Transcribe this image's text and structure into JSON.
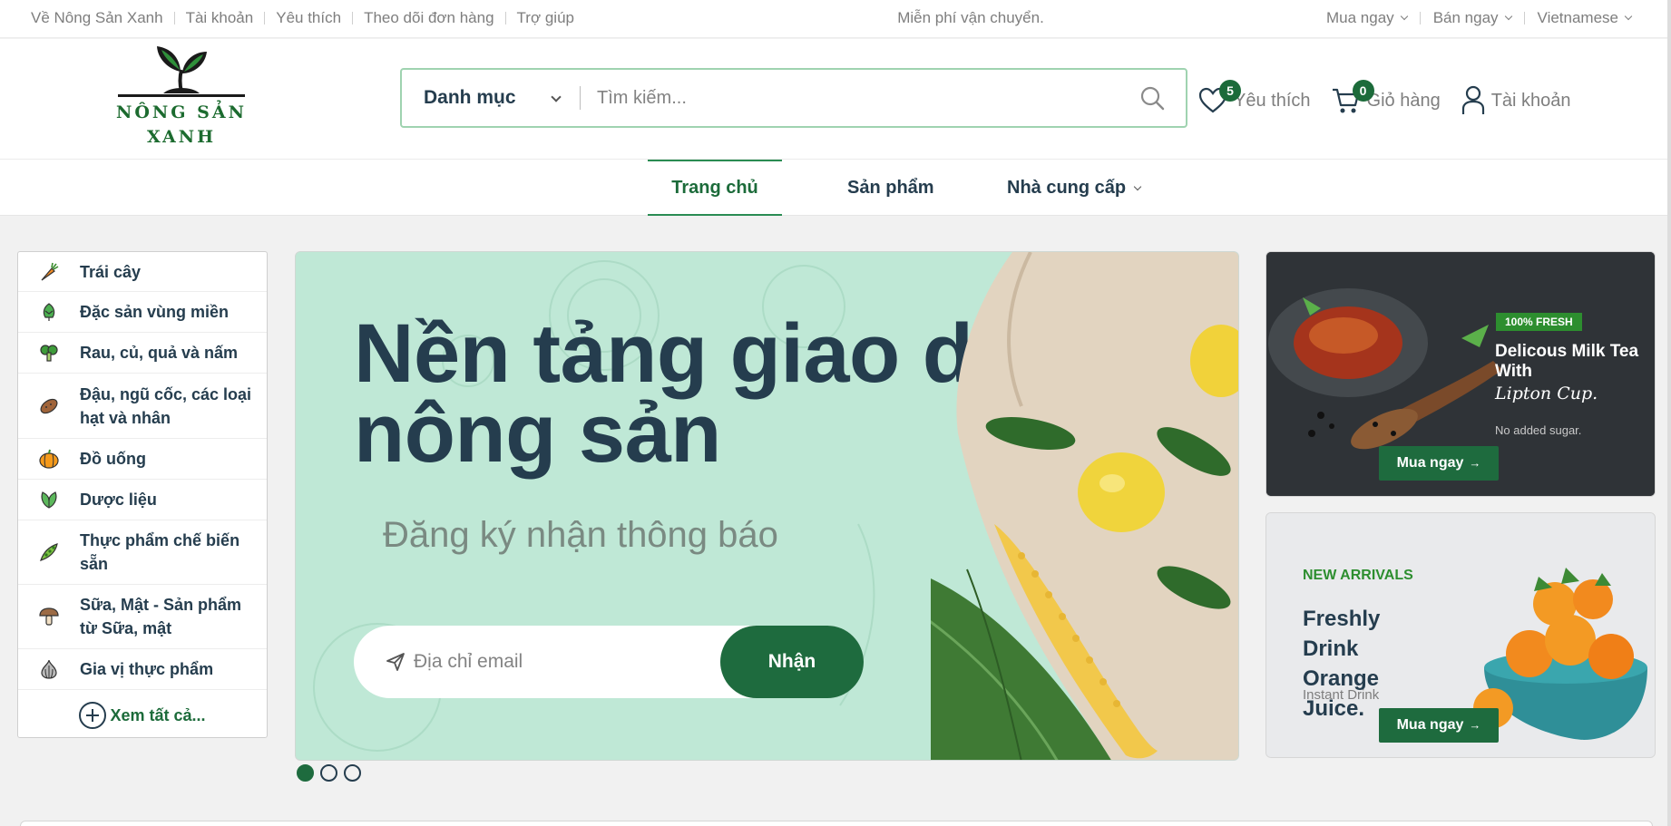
{
  "topbar": {
    "links": [
      "Về Nông Sản Xanh",
      "Tài khoản",
      "Yêu thích",
      "Theo dõi đơn hàng",
      "Trợ giúp"
    ],
    "promo": "Miễn phí vận chuyển.",
    "buy": "Mua ngay",
    "sell": "Bán ngay",
    "language": "Vietnamese"
  },
  "header": {
    "brand_line1": "NÔNG SẢN",
    "brand_line2": "XANH",
    "search": {
      "category": "Danh mục",
      "placeholder": "Tìm kiếm..."
    },
    "wishlist": {
      "label": "Yêu thích",
      "count": "5"
    },
    "cart": {
      "label": "Giỏ hàng",
      "count": "0"
    },
    "account": {
      "label": "Tài khoản"
    }
  },
  "nav": {
    "items": [
      {
        "label": "Trang chủ",
        "active": true
      },
      {
        "label": "Sản phẩm"
      },
      {
        "label": "Nhà cung cấp"
      }
    ]
  },
  "categories": {
    "items": [
      {
        "label": "Trái cây",
        "icon": "carrot-icon"
      },
      {
        "label": "Đặc sản vùng miền",
        "icon": "artichoke-icon"
      },
      {
        "label": "Rau, củ, quả và nấm",
        "icon": "broccoli-icon"
      },
      {
        "label": "Đậu, ngũ cốc, các loại hạt và nhân",
        "icon": "potato-icon"
      },
      {
        "label": "Đồ uống",
        "icon": "pumpkin-icon"
      },
      {
        "label": "Dược liệu",
        "icon": "leaf-icon"
      },
      {
        "label": "Thực phẩm chế biến sẵn",
        "icon": "peapod-icon"
      },
      {
        "label": "Sữa, Mật - Sản phẩm từ Sữa, mật",
        "icon": "mushroom-icon"
      },
      {
        "label": "Gia vị thực phẩm",
        "icon": "garlic-icon"
      }
    ],
    "more": "Xem tất cả..."
  },
  "hero": {
    "title": "Nền tảng giao dịch nông sản",
    "subtitle": "Đăng ký nhận thông báo",
    "email_placeholder": "Địa chỉ email",
    "submit": "Nhận",
    "slides": 3,
    "active_slide": 1
  },
  "banners": {
    "first": {
      "tag": "100% FRESH",
      "title": "Delicous Milk Tea With",
      "title2": "Lipton Cup.",
      "note": "No added sugar.",
      "button": "Mua ngay"
    },
    "second": {
      "tag": "NEW ARRIVALS",
      "title": "Freshly Drink Orange Juice.",
      "note": "Instant Drink",
      "button": "Mua ngay"
    }
  },
  "colors": {
    "primary": "#1e6b3e",
    "accent": "#2d8e2f",
    "hero_bg": "#bfe8d6",
    "text": "#253d4e"
  }
}
